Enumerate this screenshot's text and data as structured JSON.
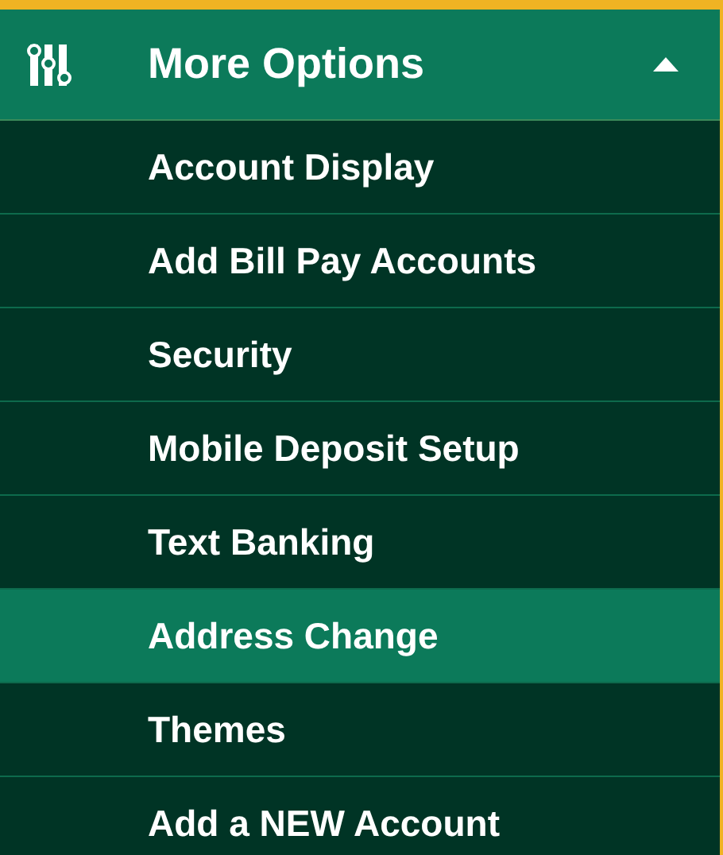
{
  "menu": {
    "title": "More Options",
    "expanded": true,
    "items": [
      {
        "label": "Account Display",
        "selected": false
      },
      {
        "label": "Add Bill Pay Accounts",
        "selected": false
      },
      {
        "label": "Security",
        "selected": false
      },
      {
        "label": "Mobile Deposit Setup",
        "selected": false
      },
      {
        "label": "Text Banking",
        "selected": false
      },
      {
        "label": "Address Change",
        "selected": true
      },
      {
        "label": "Themes",
        "selected": false
      },
      {
        "label": "Add a NEW Account",
        "selected": false
      }
    ]
  }
}
